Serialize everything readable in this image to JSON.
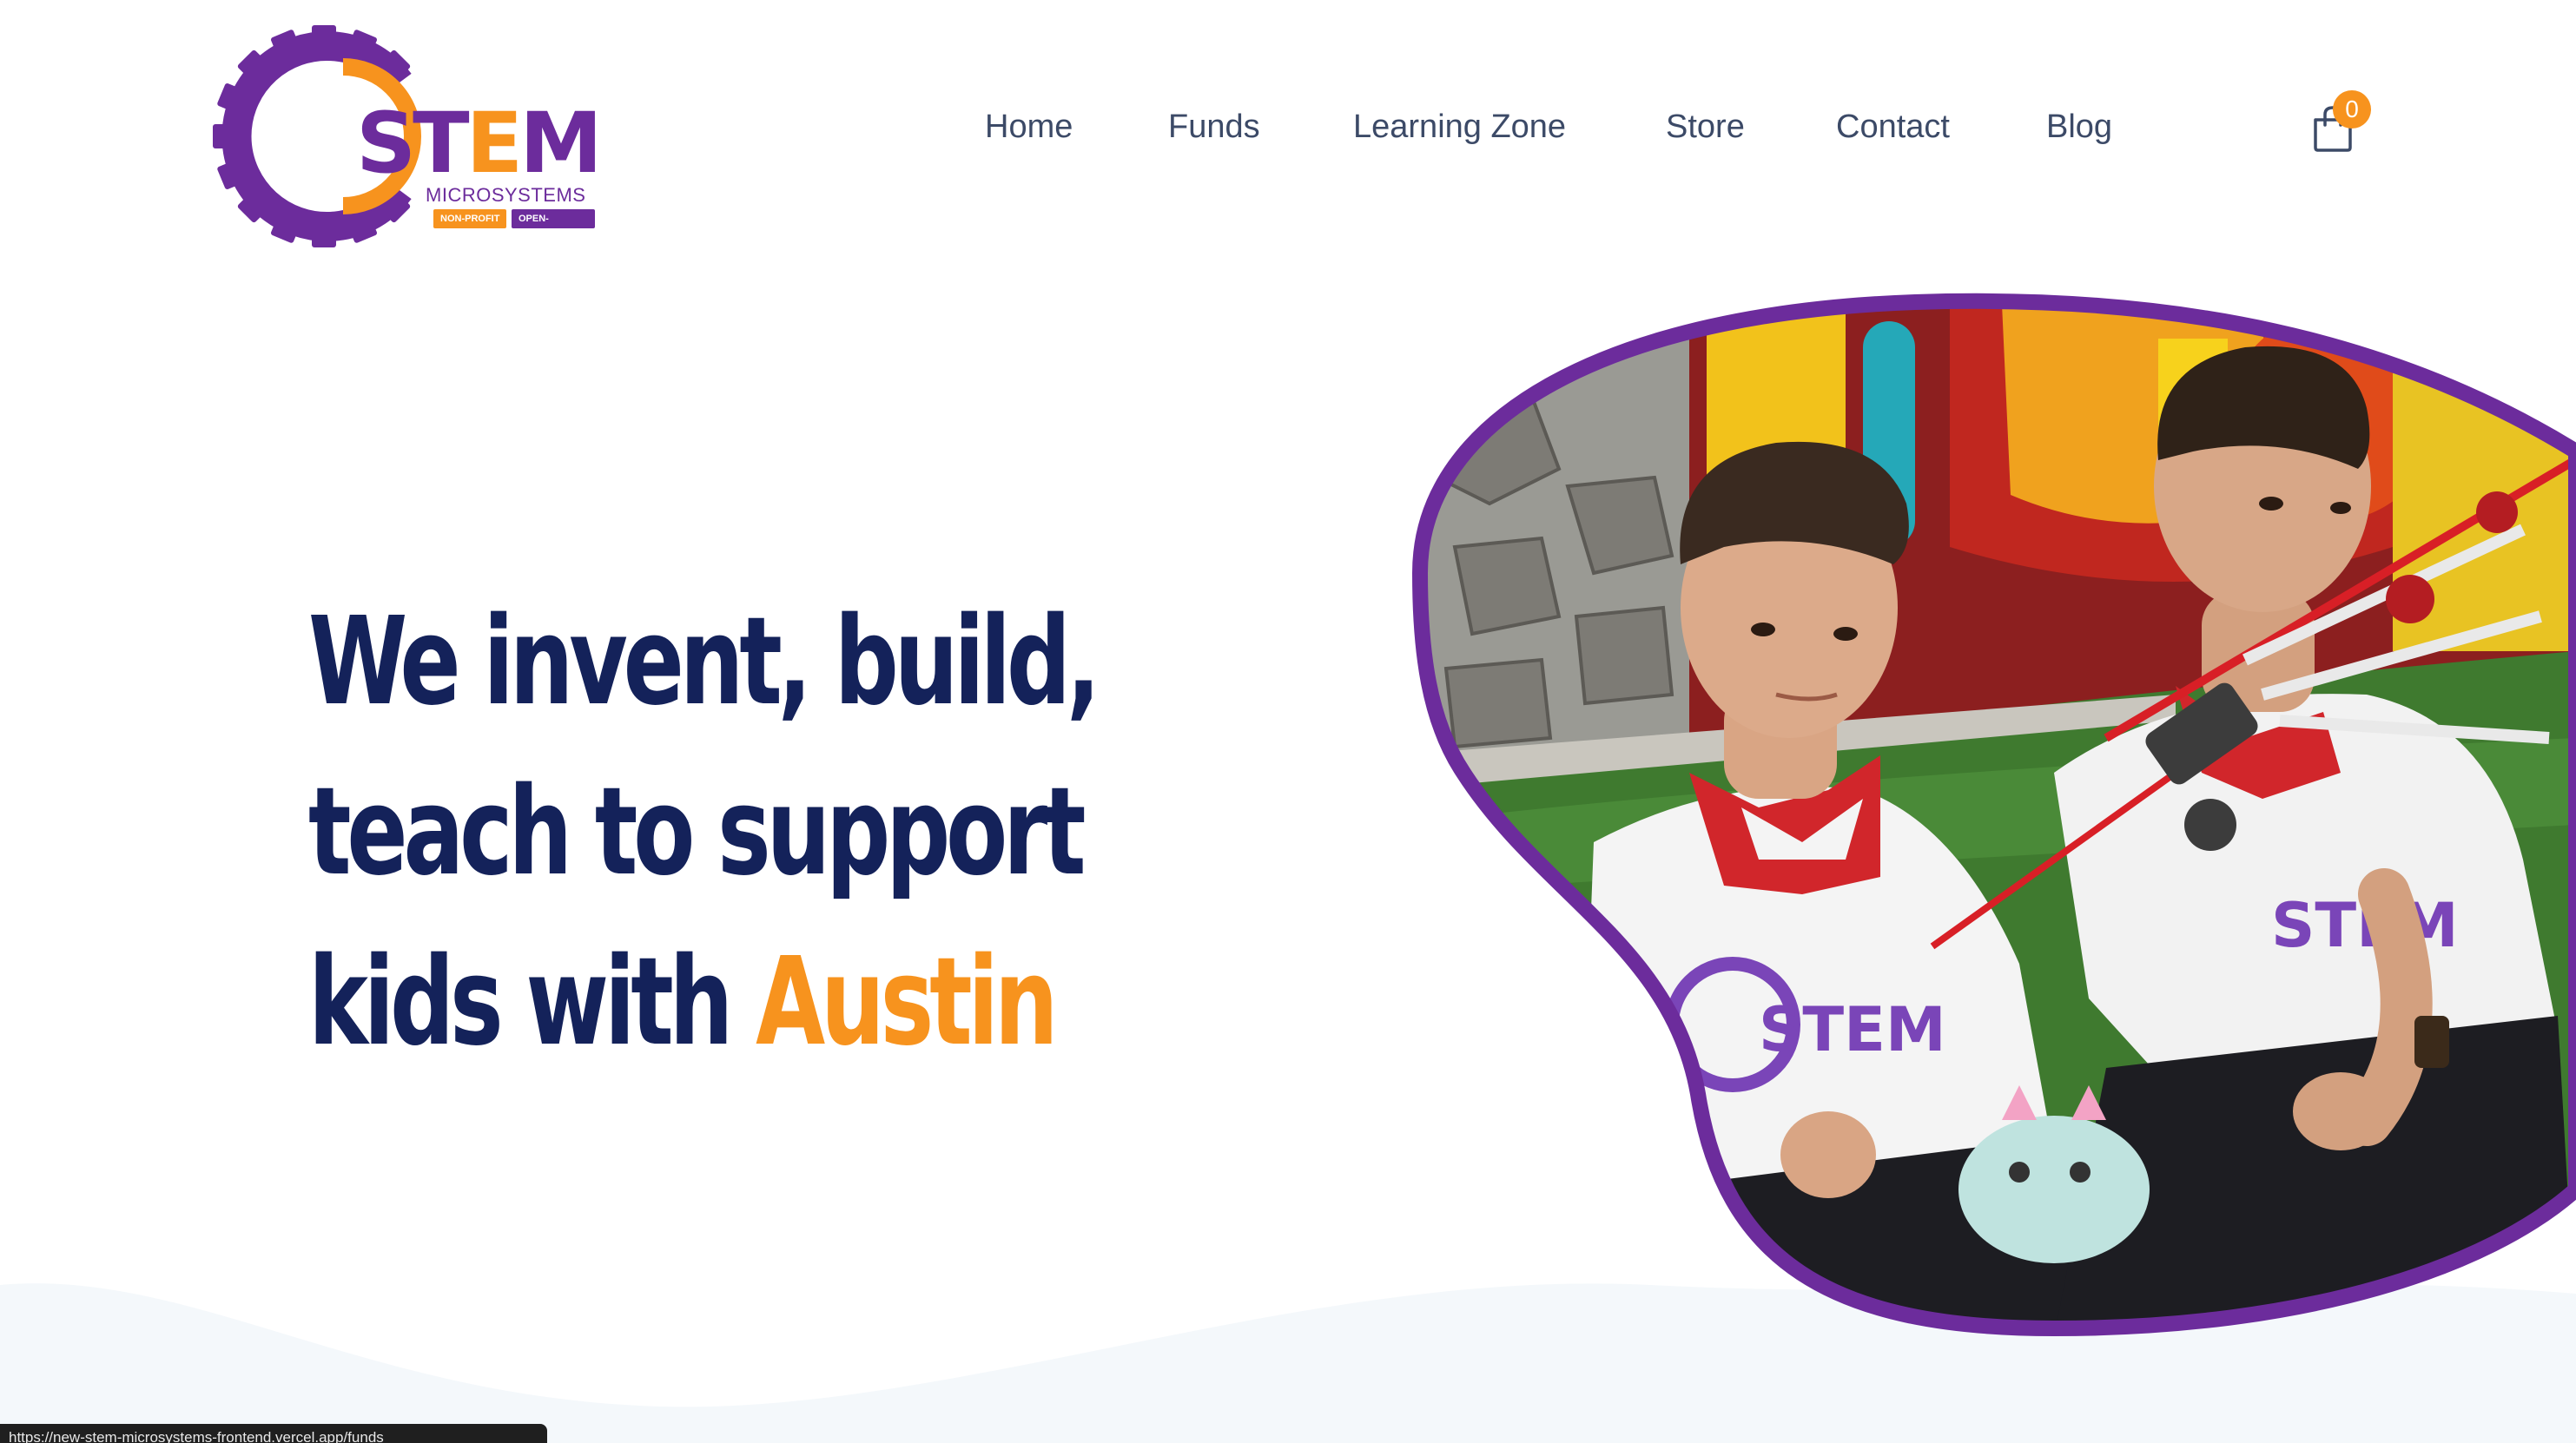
{
  "brand": {
    "logo_main_prefix": "ST",
    "logo_main_accent": "E",
    "logo_main_suffix": "M",
    "logo_sub": "MICROSYSTEMS",
    "badge_nonprofit": "NON-PROFIT",
    "badge_opensource": "OPEN-SOURCE",
    "colors": {
      "purple": "#6c2c9c",
      "orange": "#f7931e",
      "navy": "#14225a",
      "nav_text": "#3c4a67"
    }
  },
  "nav": {
    "items": [
      {
        "label": "Home"
      },
      {
        "label": "Funds"
      },
      {
        "label": "Learning Zone"
      },
      {
        "label": "Store"
      },
      {
        "label": "Contact"
      },
      {
        "label": "Blog"
      }
    ]
  },
  "cart": {
    "icon": "shopping-bag-icon",
    "count": "0"
  },
  "hero": {
    "line1": "We invent, build,",
    "line2": "teach to support",
    "line3_prefix": "kids with ",
    "line3_highlight": "Austin",
    "image": {
      "alt": "Two boys in STEM Microsystems t-shirts holding a drone",
      "shirt_logo": "STEM"
    }
  },
  "status_bar": {
    "url": "https://new-stem-microsystems-frontend.vercel.app/funds"
  }
}
